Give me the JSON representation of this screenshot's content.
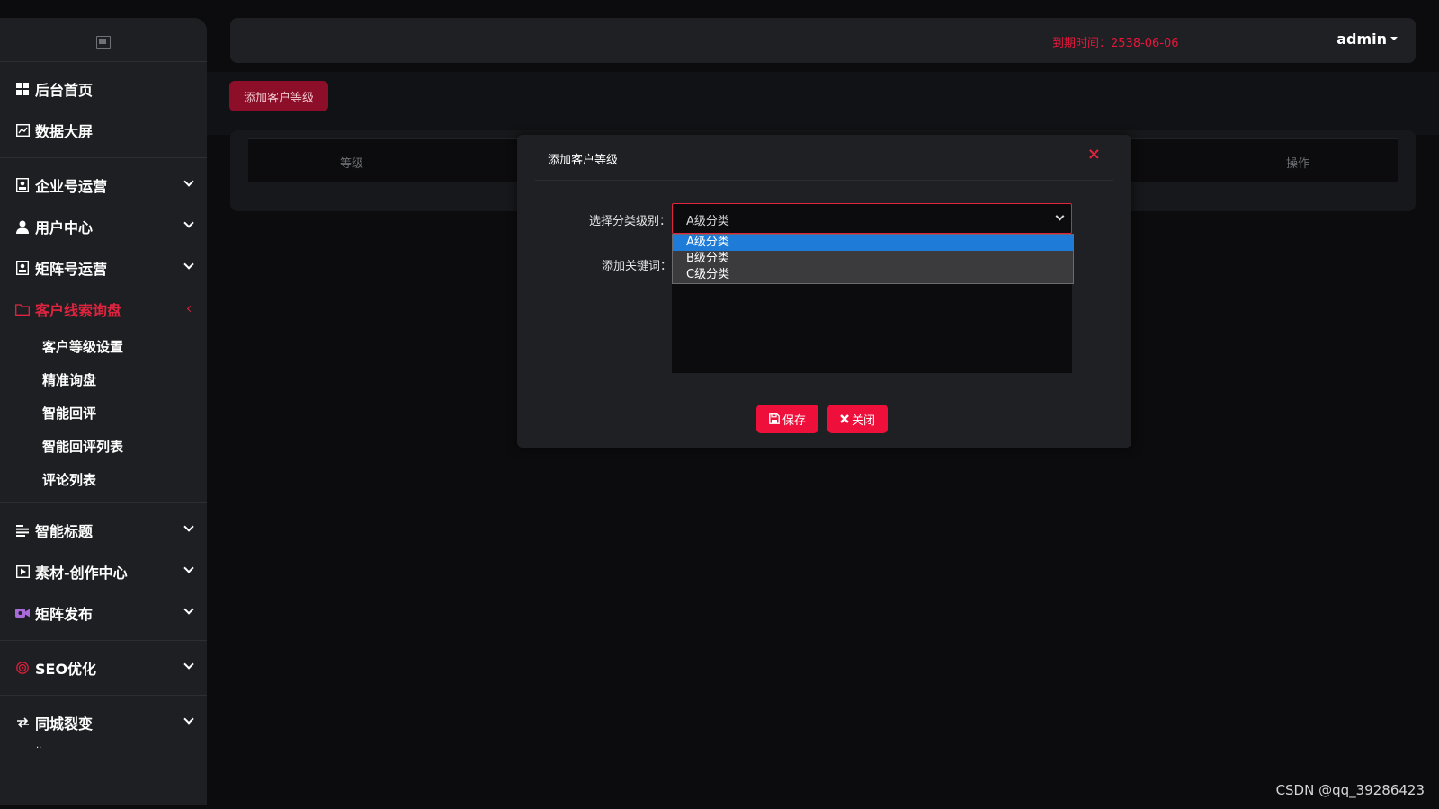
{
  "sidebar": {
    "logo_alt": "",
    "items": [
      {
        "label": "后台首页",
        "icon": "grid-icon"
      },
      {
        "label": "数据大屏",
        "icon": "chart-icon"
      },
      {
        "label": "企业号运营",
        "icon": "id-card-icon"
      },
      {
        "label": "用户中心",
        "icon": "user-icon"
      },
      {
        "label": "矩阵号运营",
        "icon": "id-card-icon"
      },
      {
        "label": "客户线索询盘",
        "icon": "folder-icon",
        "active": true
      },
      {
        "label": "智能标题",
        "icon": "text-lines-icon"
      },
      {
        "label": "素材-创作中心",
        "icon": "video-icon"
      },
      {
        "label": "矩阵发布",
        "icon": "camera-icon"
      },
      {
        "label": "SEO优化",
        "icon": "target-icon"
      },
      {
        "label": "同城裂变",
        "icon": "exchange-icon"
      }
    ],
    "sub_items": [
      "客户等级设置",
      "精准询盘",
      "智能回评",
      "智能回评列表",
      "评论列表"
    ],
    "truncated_item": "··"
  },
  "header": {
    "expiry": "到期时间：2538-06-06",
    "user": "admin"
  },
  "page": {
    "add_button": "添加客户等级",
    "table_headers": [
      "等级",
      "操作"
    ]
  },
  "modal": {
    "title": "添加客户等级",
    "close_symbol": "×",
    "select_label": "选择分类级别：",
    "select_value": "A级分类",
    "options": [
      "A级分类",
      "B级分类",
      "C级分类"
    ],
    "keyword_label": "添加关键词：",
    "save_label": "保存",
    "close_label": "关闭"
  },
  "colors": {
    "accent": "#ee0f3a",
    "background": "#0c0c0e",
    "panel": "#1f2024",
    "option_highlight": "#1e7cd8"
  },
  "watermark": "CSDN @qq_39286423"
}
